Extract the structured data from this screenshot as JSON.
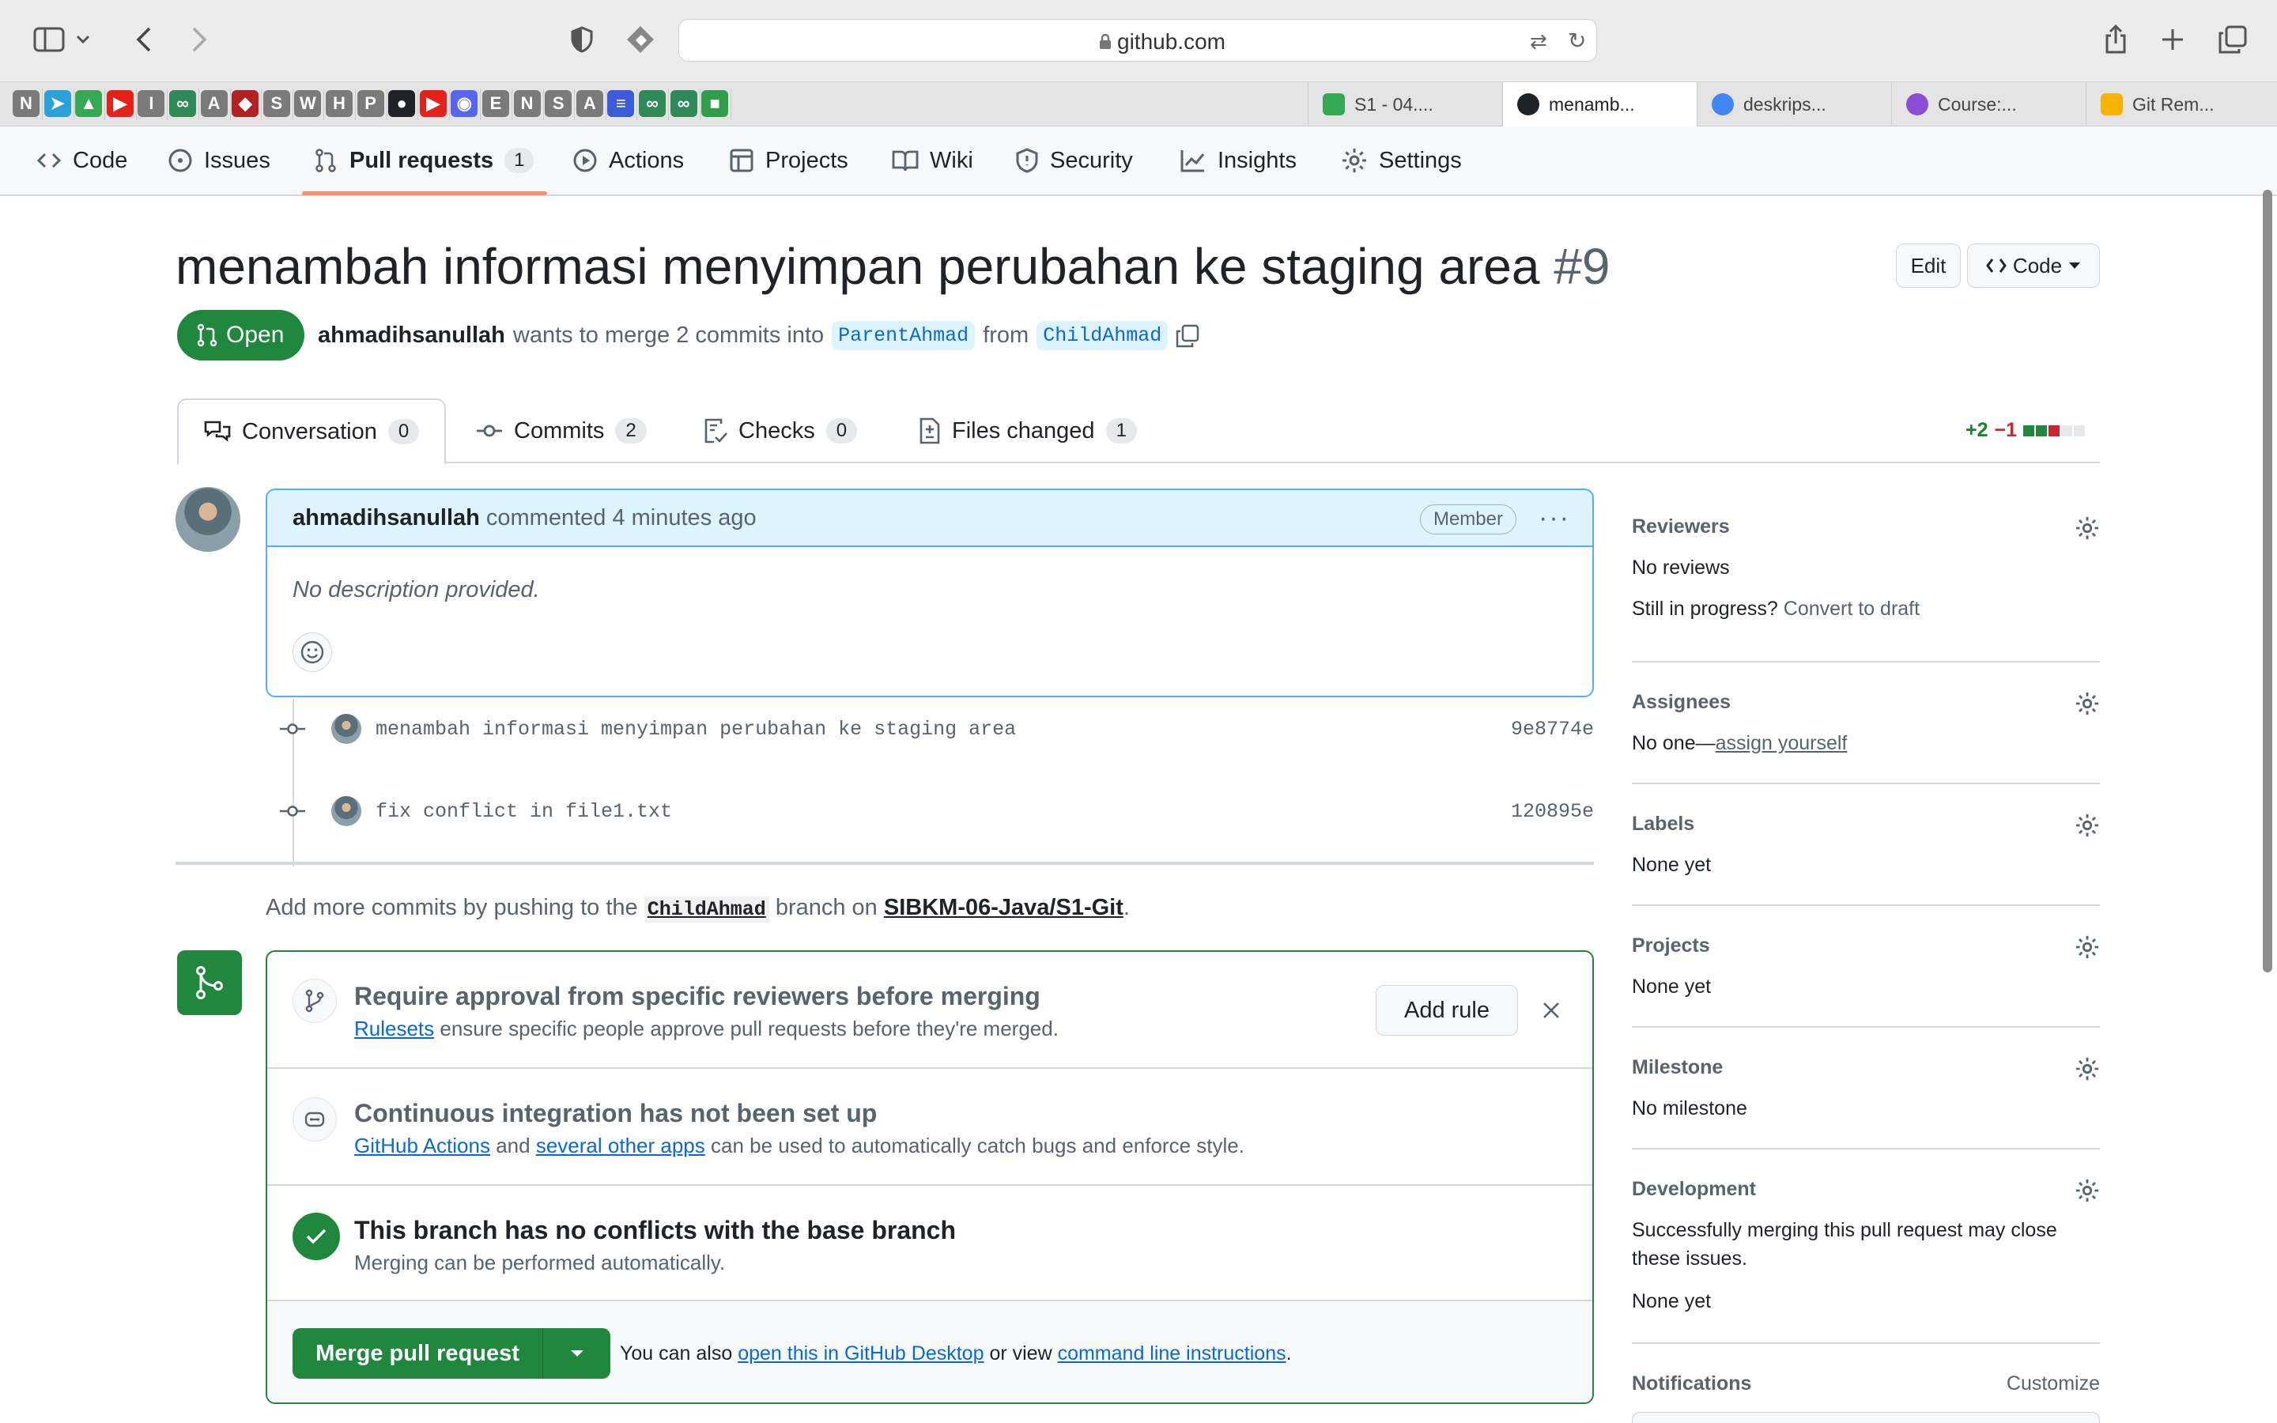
{
  "browser": {
    "url": "github.com",
    "tabs": [
      {
        "label": "S1 - 04....",
        "color": "#34a853"
      },
      {
        "label": "menamb...",
        "color": "#1f2328"
      },
      {
        "label": "deskrips...",
        "color": "#4285f4"
      },
      {
        "label": "Course:...",
        "color": "#8a4dd6"
      },
      {
        "label": "Git Rem...",
        "color": "#f4b400"
      }
    ],
    "favorites": [
      {
        "letter": "N",
        "color": "#7a7a7a"
      },
      {
        "letter": "➤",
        "color": "#2aa1da"
      },
      {
        "letter": "▲",
        "color": "#34a853"
      },
      {
        "letter": "▶",
        "color": "#e62117"
      },
      {
        "letter": "I",
        "color": "#7a7a7a"
      },
      {
        "letter": "∞",
        "color": "#2e8b57"
      },
      {
        "letter": "A",
        "color": "#7a7a7a"
      },
      {
        "letter": "◆",
        "color": "#b22222"
      },
      {
        "letter": "S",
        "color": "#7a7a7a"
      },
      {
        "letter": "W",
        "color": "#7a7a7a"
      },
      {
        "letter": "H",
        "color": "#7a7a7a"
      },
      {
        "letter": "P",
        "color": "#7a7a7a"
      },
      {
        "letter": "●",
        "color": "#1f2328"
      },
      {
        "letter": "▶",
        "color": "#e62117"
      },
      {
        "letter": "◉",
        "color": "#5865f2"
      },
      {
        "letter": "E",
        "color": "#7a7a7a"
      },
      {
        "letter": "N",
        "color": "#7a7a7a"
      },
      {
        "letter": "S",
        "color": "#7a7a7a"
      },
      {
        "letter": "A",
        "color": "#7a7a7a"
      },
      {
        "letter": "≡",
        "color": "#3b5bdb"
      },
      {
        "letter": "∞",
        "color": "#2e8b57"
      },
      {
        "letter": "∞",
        "color": "#2e8b57"
      },
      {
        "letter": "■",
        "color": "#2e9e4a"
      }
    ]
  },
  "repo_nav": [
    {
      "label": "Code",
      "icon": "code-icon"
    },
    {
      "label": "Issues",
      "icon": "issue-icon"
    },
    {
      "label": "Pull requests",
      "icon": "pull-request-icon",
      "count": "1",
      "active": true
    },
    {
      "label": "Actions",
      "icon": "play-icon"
    },
    {
      "label": "Projects",
      "icon": "table-icon"
    },
    {
      "label": "Wiki",
      "icon": "book-icon"
    },
    {
      "label": "Security",
      "icon": "shield-icon"
    },
    {
      "label": "Insights",
      "icon": "graph-icon"
    },
    {
      "label": "Settings",
      "icon": "gear-icon"
    }
  ],
  "pr": {
    "title": "menambah informasi menyimpan perubahan ke staging area",
    "number": "#9",
    "edit_label": "Edit",
    "code_label": "Code",
    "state": "Open",
    "author": "ahmadihsanullah",
    "merge_text": "wants to merge 2 commits into",
    "base_branch": "ParentAhmad",
    "from_text": "from",
    "head_branch": "ChildAhmad"
  },
  "tabs": [
    {
      "label": "Conversation",
      "count": "0",
      "icon": "comment-discussion-icon"
    },
    {
      "label": "Commits",
      "count": "2",
      "icon": "commit-icon"
    },
    {
      "label": "Checks",
      "count": "0",
      "icon": "checklist-icon"
    },
    {
      "label": "Files changed",
      "count": "1",
      "icon": "file-diff-icon"
    }
  ],
  "diffstat": {
    "additions": "+2",
    "deletions": "−1",
    "colors": [
      "#1f883d",
      "#1f883d",
      "#cf222e",
      "#e6e9ec",
      "#e6e9ec"
    ]
  },
  "comment": {
    "author": "ahmadihsanullah",
    "action": "commented 4 minutes ago",
    "badge": "Member",
    "body": "No description provided."
  },
  "commits": [
    {
      "message": "menambah informasi menyimpan perubahan ke staging area",
      "sha": "9e8774e"
    },
    {
      "message": "fix conflict in file1.txt",
      "sha": "120895e"
    }
  ],
  "push_hint": {
    "prefix": "Add more commits by pushing to the",
    "branch": "ChildAhmad",
    "middle": "branch on",
    "repo": "SIBKM-06-Java/S1-Git",
    "suffix": "."
  },
  "merge_box": {
    "rules_title": "Require approval from specific reviewers before merging",
    "rules_link": "Rulesets",
    "rules_sub": "ensure specific people approve pull requests before they're merged.",
    "add_rule": "Add rule",
    "ci_title": "Continuous integration has not been set up",
    "ci_link1": "GitHub Actions",
    "ci_and": "and",
    "ci_link2": "several other apps",
    "ci_sub": "can be used to automatically catch bugs and enforce style.",
    "conflict_title": "This branch has no conflicts with the base branch",
    "conflict_sub": "Merging can be performed automatically.",
    "merge_button": "Merge pull request",
    "also_prefix": "You can also",
    "also_link1": "open this in GitHub Desktop",
    "also_mid": "or view",
    "also_link2": "command line instructions",
    "also_suffix": "."
  },
  "sidebar": {
    "reviewers": {
      "title": "Reviewers",
      "value": "No reviews",
      "draft_prefix": "Still in progress?",
      "draft_link": "Convert to draft"
    },
    "assignees": {
      "title": "Assignees",
      "prefix": "No one—",
      "link": "assign yourself"
    },
    "labels": {
      "title": "Labels",
      "value": "None yet"
    },
    "projects": {
      "title": "Projects",
      "value": "None yet"
    },
    "milestone": {
      "title": "Milestone",
      "value": "No milestone"
    },
    "development": {
      "title": "Development",
      "line1": "Successfully merging this pull request may close",
      "line2": "these issues.",
      "value": "None yet"
    },
    "notifications": {
      "title": "Notifications",
      "action": "Customize"
    }
  }
}
